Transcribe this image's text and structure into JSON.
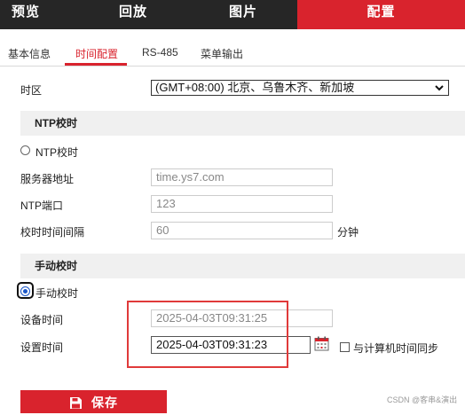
{
  "topnav": {
    "items": [
      "预览",
      "回放",
      "图片",
      "配置"
    ],
    "active_index": 3,
    "active_color": "#d9232d",
    "background": "#262626"
  },
  "subtabs": {
    "items": [
      "基本信息",
      "时间配置",
      "RS-485",
      "菜单输出"
    ],
    "active_index": 1
  },
  "timezone": {
    "label": "时区",
    "value": "(GMT+08:00) 北京、乌鲁木齐、新加坡"
  },
  "ntp": {
    "section_title": "NTP校时",
    "radio_label": "NTP校时",
    "radio_checked": false,
    "server_label": "服务器地址",
    "server_value": "time.ys7.com",
    "port_label": "NTP端口",
    "port_value": "123",
    "interval_label": "校时时间间隔",
    "interval_value": "60",
    "interval_unit": "分钟"
  },
  "manual": {
    "section_title": "手动校时",
    "radio_label": "手动校时",
    "radio_checked": true,
    "device_time_label": "设备时间",
    "device_time_value": "2025-04-03T09:31:25",
    "set_time_label": "设置时间",
    "set_time_value": "2025-04-03T09:31:23",
    "calendar_icon": "calendar-icon",
    "sync_label": "与计算机时间同步",
    "sync_checked": false
  },
  "annotation_color": "#e03a3a",
  "save": {
    "label": "保存",
    "icon": "save-icon"
  },
  "watermark": "CSDN @客串&演出"
}
